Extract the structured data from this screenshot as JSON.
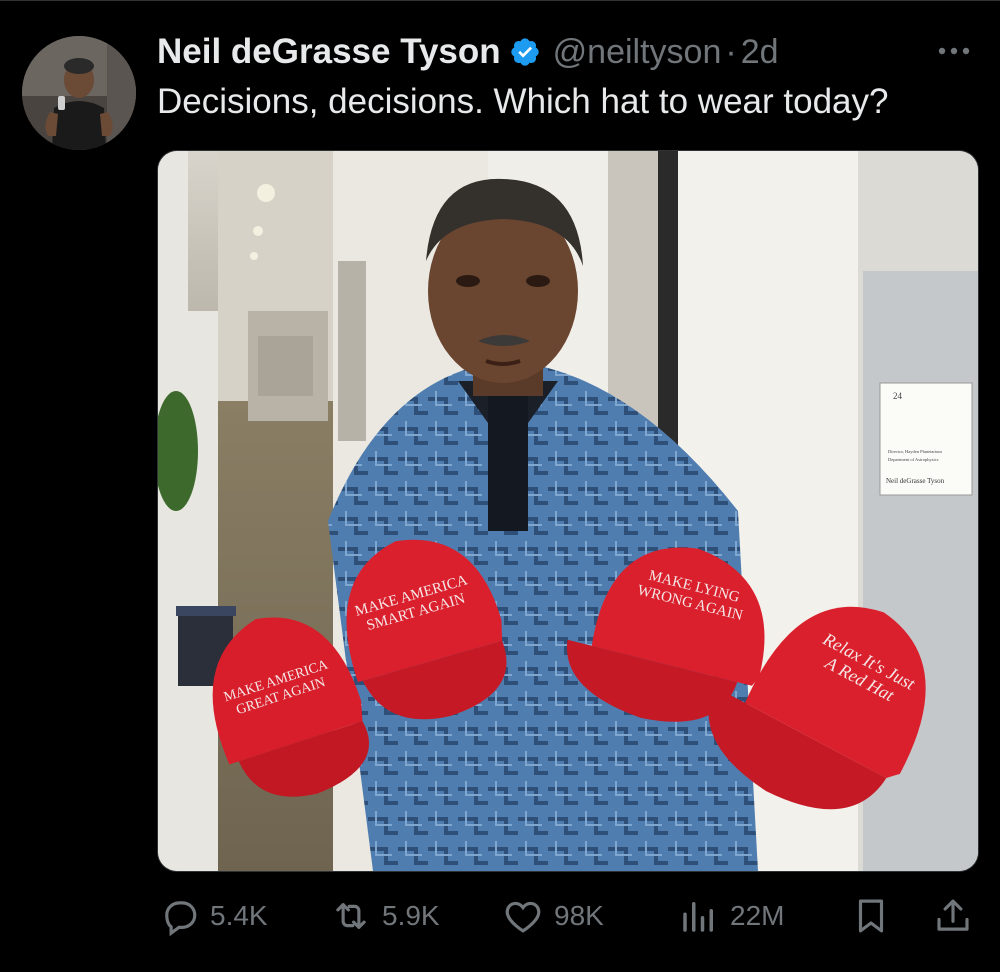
{
  "tweet": {
    "author_name": "Neil deGrasse Tyson",
    "handle": "@neiltyson",
    "separator": "·",
    "time": "2d",
    "text": "Decisions, decisions. Which hat to wear today?"
  },
  "media": {
    "door_sign_number": "24",
    "door_sign_line1": "Director, Hayden Planetarium",
    "door_sign_line2": "Department of Astrophysics",
    "door_sign_name": "Neil deGrasse Tyson",
    "hats": [
      {
        "line1": "MAKE AMERICA",
        "line2": "GREAT AGAIN"
      },
      {
        "line1": "MAKE AMERICA",
        "line2": "SMART AGAIN"
      },
      {
        "line1": "MAKE LYING",
        "line2": "WRONG AGAIN"
      },
      {
        "line1": "Relax It's Just",
        "line2": "A Red Hat"
      }
    ]
  },
  "actions": {
    "replies": "5.4K",
    "reposts": "5.9K",
    "likes": "98K",
    "views": "22M"
  },
  "colors": {
    "accent": "#1d9bf0",
    "muted": "#71767b",
    "text": "#e7e9ea",
    "hat_red": "#d81e2b"
  },
  "icons": {
    "verified": "verified-badge-icon",
    "more": "more-horizontal-icon",
    "reply": "reply-icon",
    "repost": "repost-icon",
    "like": "heart-icon",
    "views": "views-chart-icon",
    "bookmark": "bookmark-icon",
    "share": "share-icon"
  }
}
